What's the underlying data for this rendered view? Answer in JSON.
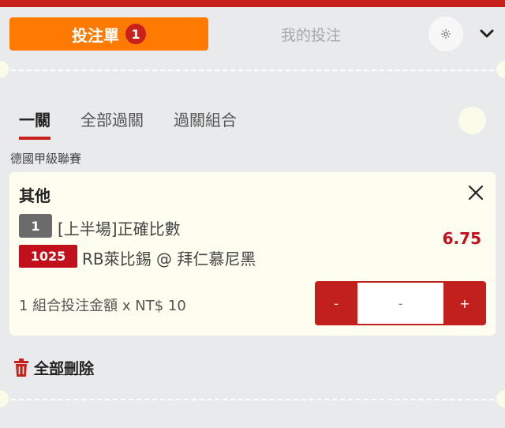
{
  "header": {
    "tabs": [
      {
        "label": "投注單",
        "count": "1"
      },
      {
        "label": "我的投注"
      }
    ]
  },
  "subtabs": [
    "一關",
    "全部過關",
    "過關組合"
  ],
  "league": "德國甲級聯賽",
  "bet": {
    "title": "其他",
    "market_num": "1",
    "market": "[上半場]正確比數",
    "match_code": "1025",
    "match": "RB萊比錫 @ 拜仁慕尼黑",
    "odds": "6.75",
    "stake_label": "1 組合投注金額 x NT$ 10",
    "stepper": {
      "minus": "-",
      "value": "-",
      "plus": "+"
    }
  },
  "delete_all": "全部刪除",
  "colors": {
    "brand_red": "#c8201d",
    "accent_orange": "#ff7a00",
    "background": "#e9eaec",
    "card": "#fdfdf0"
  },
  "icons": [
    "gear-icon",
    "chevron-down-icon",
    "close-icon",
    "trash-icon"
  ]
}
